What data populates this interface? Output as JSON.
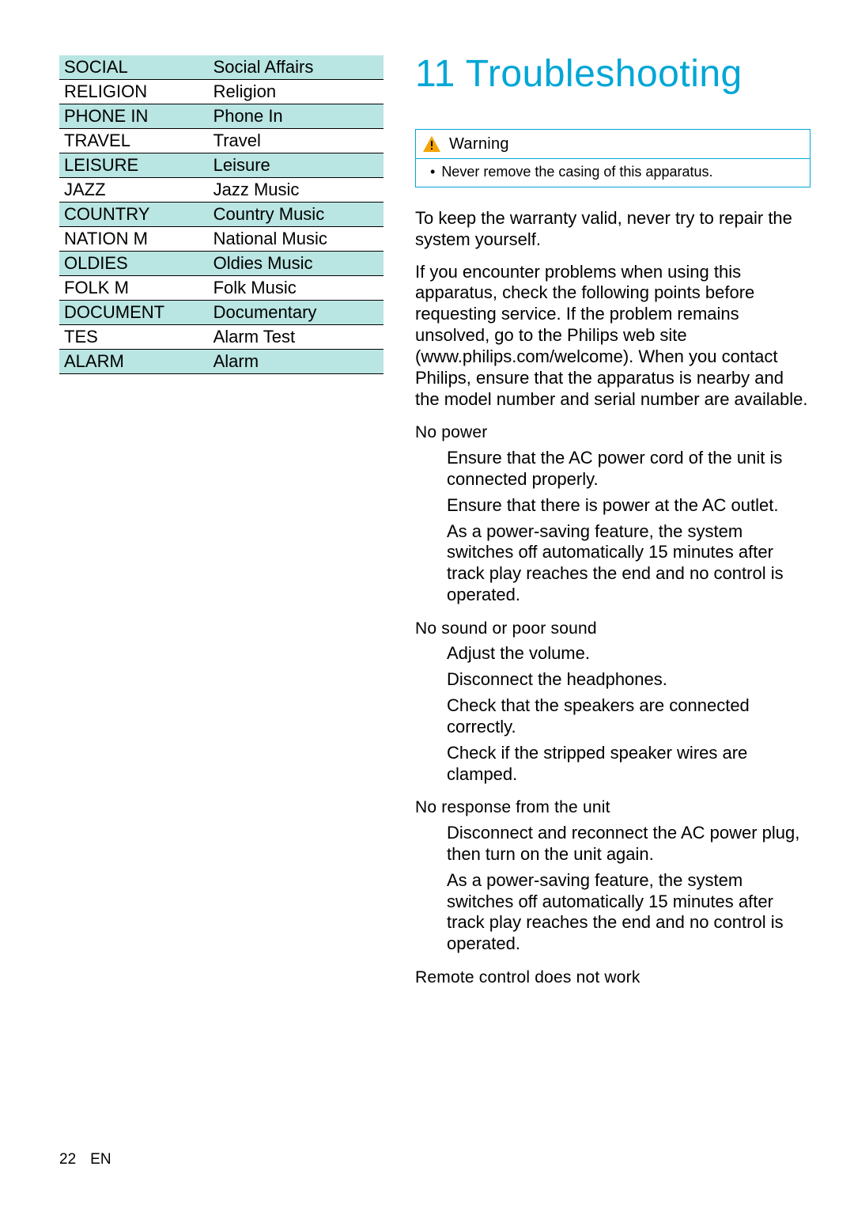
{
  "table_rows": [
    {
      "code": "SOCIAL",
      "desc": "Social Affairs"
    },
    {
      "code": "RELIGION",
      "desc": "Religion"
    },
    {
      "code": "PHONE IN",
      "desc": "Phone In"
    },
    {
      "code": "TRAVEL",
      "desc": "Travel"
    },
    {
      "code": "LEISURE",
      "desc": "Leisure"
    },
    {
      "code": "JAZZ",
      "desc": "Jazz Music"
    },
    {
      "code": "COUNTRY",
      "desc": "Country Music"
    },
    {
      "code": "NATION M",
      "desc": "National Music"
    },
    {
      "code": "OLDIES",
      "desc": "Oldies Music"
    },
    {
      "code": "FOLK M",
      "desc": "Folk Music"
    },
    {
      "code": "DOCUMENT",
      "desc": "Documentary"
    },
    {
      "code": "TES",
      "desc": "Alarm Test"
    },
    {
      "code": "ALARM",
      "desc": "Alarm"
    }
  ],
  "section_title": "11 Troubleshooting",
  "warning": {
    "label": "Warning",
    "text": "Never remove the casing of this apparatus."
  },
  "intro": {
    "warranty": "To keep the warranty valid, never try to repair the system yourself.",
    "service": "If you encounter problems when using this apparatus, check the following points before requesting service. If the problem remains unsolved, go to the Philips web site (www.philips.com/welcome). When you contact Philips, ensure that the apparatus is nearby and the model number and serial number are available."
  },
  "issues": {
    "no_power": {
      "heading": "No power",
      "items": [
        "Ensure that the AC power cord of the unit is connected properly.",
        "Ensure that there is power at the AC outlet.",
        "As a power-saving feature, the system switches off automatically 15 minutes after track play reaches the end and no control is operated."
      ]
    },
    "no_sound": {
      "heading": "No sound or poor sound",
      "items": [
        "Adjust the volume.",
        "Disconnect the headphones.",
        "Check that the speakers are connected correctly.",
        "Check if the stripped speaker wires are clamped."
      ]
    },
    "no_response": {
      "heading": "No response from the unit",
      "items": [
        "Disconnect and reconnect the AC power plug, then turn on the unit again.",
        "As a power-saving feature, the system switches off automatically 15 minutes after track play reaches the end and no control is operated."
      ]
    },
    "remote": {
      "heading": "Remote control does not work"
    }
  },
  "footer": {
    "page": "22",
    "lang": "EN"
  }
}
